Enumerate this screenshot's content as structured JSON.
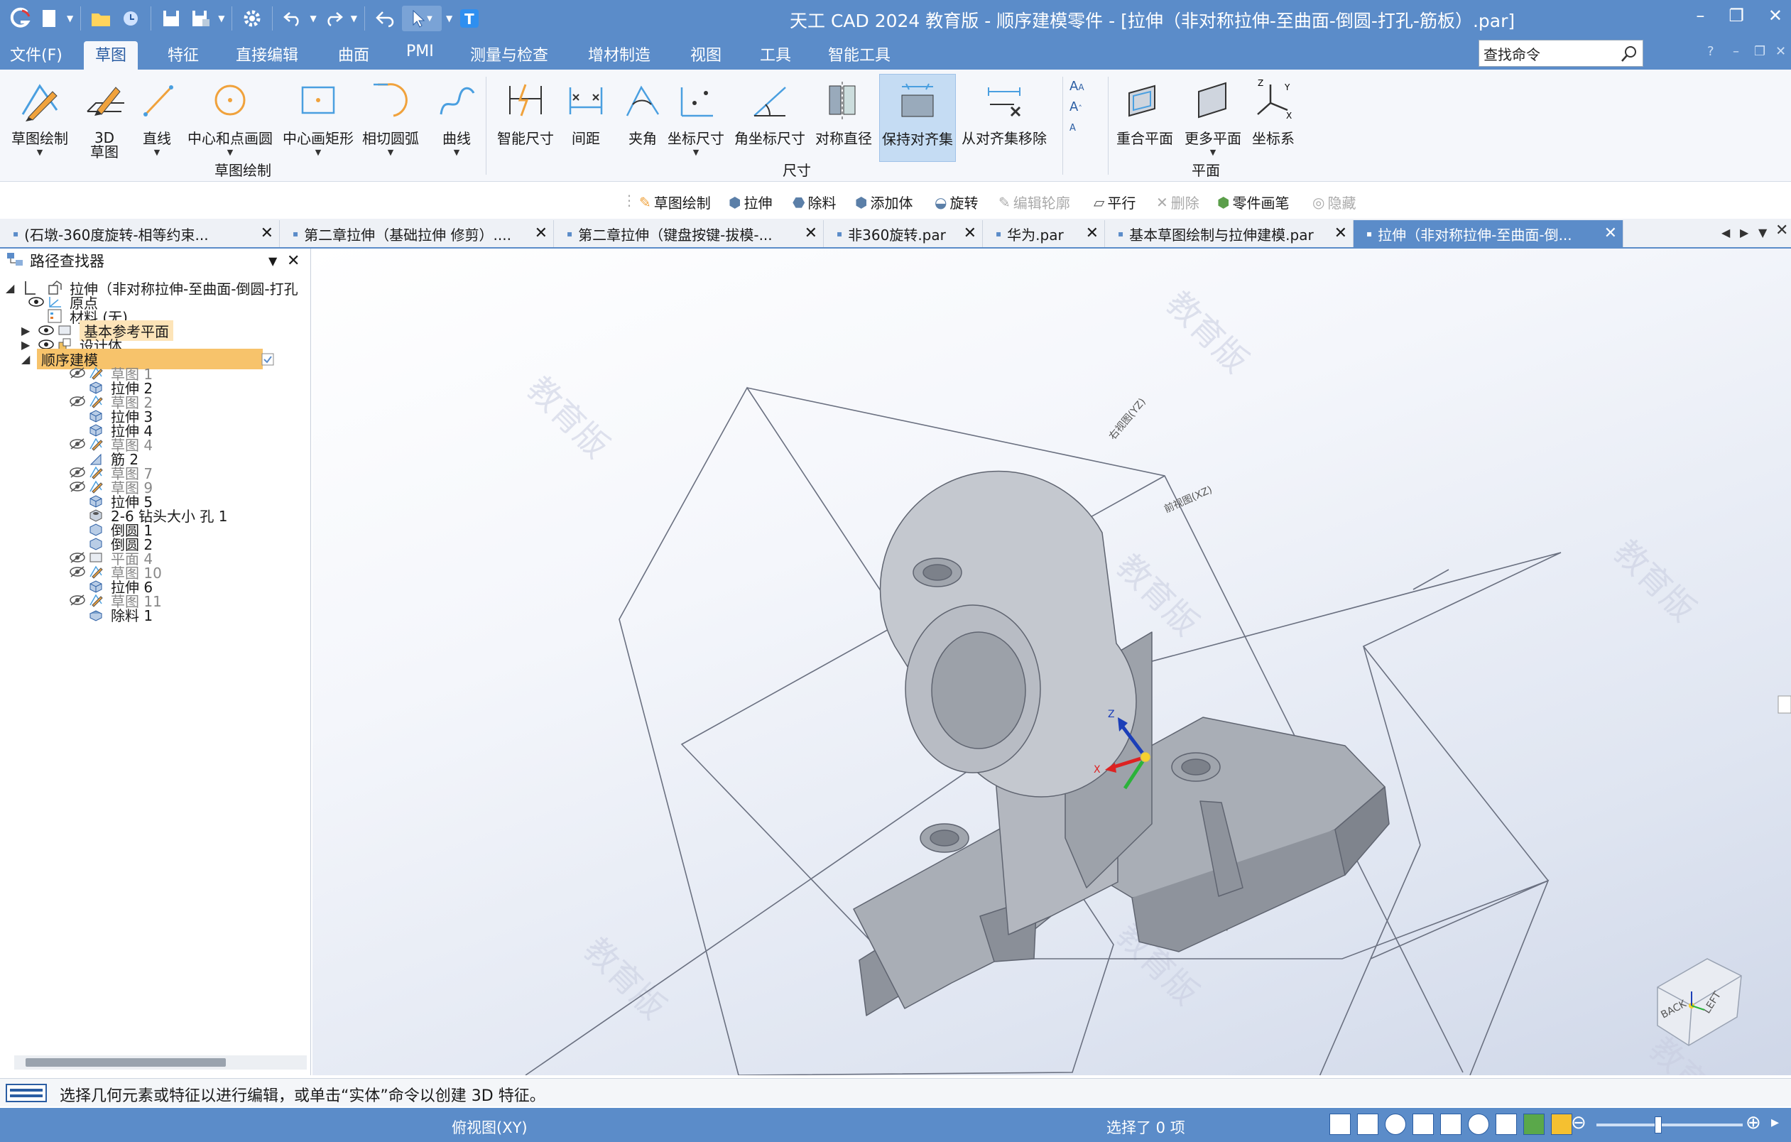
{
  "window": {
    "title": "天工 CAD 2024 教育版 - 顺序建模零件 - [拉伸（非对称拉伸-至曲面-倒圆-打孔-筋板）.par]"
  },
  "menubar": {
    "items": [
      "文件(F)",
      "草图",
      "特征",
      "直接编辑",
      "曲面",
      "PMI",
      "测量与检查",
      "增材制造",
      "视图",
      "工具",
      "智能工具"
    ],
    "active": "草图",
    "search_placeholder": "查找命令"
  },
  "ribbon": {
    "buttons": {
      "sketch_draw": "草图绘制",
      "sketch_3d": "3D\n草图",
      "line": "直线",
      "center_circle": "中心和点画圆",
      "center_rect": "中心画矩形",
      "tangent_arc": "相切圆弧",
      "curve": "曲线",
      "smart_dim": "智能尺寸",
      "distance": "间距",
      "angle": "夹角",
      "coord_dim": "坐标尺寸",
      "angle_coord_dim": "角坐标尺寸",
      "sym_diameter": "对称直径",
      "keep_aligned": "保持对齐集",
      "remove_aligned": "从对齐集移除",
      "coincident_plane": "重合平面",
      "more_planes": "更多平面",
      "coord_system": "坐标系"
    },
    "groups": {
      "sketch": "草图绘制",
      "dimension": "尺寸",
      "plane": "平面"
    }
  },
  "context_toolbar": {
    "items": [
      {
        "label": "草图绘制",
        "enabled": true
      },
      {
        "label": "拉伸",
        "enabled": true
      },
      {
        "label": "除料",
        "enabled": true
      },
      {
        "label": "添加体",
        "enabled": true
      },
      {
        "label": "旋转",
        "enabled": true
      },
      {
        "label": "编辑轮廓",
        "enabled": false
      },
      {
        "label": "平行",
        "enabled": true
      },
      {
        "label": "删除",
        "enabled": false
      },
      {
        "label": "零件画笔",
        "enabled": true
      },
      {
        "label": "隐藏",
        "enabled": false
      }
    ]
  },
  "tabs": [
    {
      "label": "(石墩-360度旋转-相等约束...",
      "active": false
    },
    {
      "label": "第二章拉伸（基础拉伸 修剪）....",
      "active": false
    },
    {
      "label": "第二章拉伸（键盘按键-拔模-...",
      "active": false
    },
    {
      "label": "非360旋转.par",
      "active": false
    },
    {
      "label": "华为.par",
      "active": false
    },
    {
      "label": "基本草图绘制与拉伸建模.par",
      "active": false
    },
    {
      "label": "拉伸（非对称拉伸-至曲面-倒...",
      "active": true
    }
  ],
  "pathfinder": {
    "title": "路径查找器",
    "root": "拉伸（非对称拉伸-至曲面-倒圆-打孔",
    "items": [
      {
        "label": "原点",
        "dim": false
      },
      {
        "label": "材料 (无)",
        "dim": false
      },
      {
        "label": "基本参考平面",
        "dim": false
      },
      {
        "label": "设计体",
        "dim": false
      },
      {
        "label": "顺序建模",
        "dim": false
      },
      {
        "label": "草图 1",
        "dim": true
      },
      {
        "label": "拉伸 2",
        "dim": false
      },
      {
        "label": "草图 2",
        "dim": true
      },
      {
        "label": "拉伸 3",
        "dim": false
      },
      {
        "label": "拉伸 4",
        "dim": false
      },
      {
        "label": "草图 4",
        "dim": true
      },
      {
        "label": "筋 2",
        "dim": false
      },
      {
        "label": "草图 7",
        "dim": true
      },
      {
        "label": "草图 9",
        "dim": true
      },
      {
        "label": "拉伸 5",
        "dim": false
      },
      {
        "label": "2-6 钻头大小 孔 1",
        "dim": false
      },
      {
        "label": "倒圆 1",
        "dim": false
      },
      {
        "label": "倒圆 2",
        "dim": false
      },
      {
        "label": "平面 4",
        "dim": true
      },
      {
        "label": "草图 10",
        "dim": true
      },
      {
        "label": "拉伸 6",
        "dim": false
      },
      {
        "label": "草图 11",
        "dim": true
      },
      {
        "label": "除料 1",
        "dim": false
      }
    ]
  },
  "viewport": {
    "watermark": "教育版",
    "plane_labels": {
      "right": "右视图(YZ)",
      "front": "前视图(XZ)",
      "top": "俯视图(XY)"
    },
    "axes": {
      "x": "X",
      "z": "Z"
    },
    "viewcube": {
      "back": "BACK",
      "left": "LEFT"
    }
  },
  "status": {
    "prompt": "选择几何元素或特征以进行编辑，或单击“实体”命令以创建 3D 特征。",
    "view_name": "俯视图(XY)",
    "selection": "选择了 0 项"
  },
  "colors": {
    "title_bar": "#5b8cc9",
    "ribbon_bg": "#f5f7fb",
    "active_tab": "#5b8cc9",
    "sequential_highlight": "#f7c36b",
    "part_gray": "#a8adb5"
  }
}
